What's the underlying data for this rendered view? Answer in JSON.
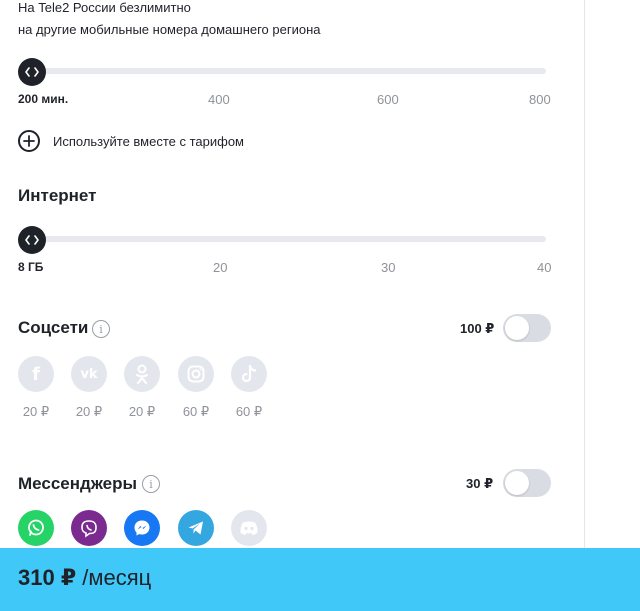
{
  "calls": {
    "line1": "На Tele2 России безлимитно",
    "line2": "на другие мобильные номера домашнего региона",
    "ticks": [
      "200 мин.",
      "400",
      "600",
      "800"
    ],
    "add_option_label": "Используйте вместе с тарифом"
  },
  "internet": {
    "title": "Интернет",
    "ticks": [
      "8 ГБ",
      "20",
      "30",
      "40"
    ]
  },
  "social": {
    "title": "Соцсети",
    "price": "100 ₽",
    "enabled": false,
    "apps": [
      {
        "icon": "facebook-icon",
        "price": "20 ₽"
      },
      {
        "icon": "vk-icon",
        "price": "20 ₽"
      },
      {
        "icon": "odnoklassniki-icon",
        "price": "20 ₽"
      },
      {
        "icon": "instagram-icon",
        "price": "60 ₽"
      },
      {
        "icon": "tiktok-icon",
        "price": "60 ₽"
      }
    ]
  },
  "messengers": {
    "title": "Мессенджеры",
    "price": "30 ₽",
    "enabled": false,
    "apps": [
      {
        "icon": "whatsapp-icon",
        "color": "#25d366"
      },
      {
        "icon": "viber-icon",
        "color": "#7b2a8f"
      },
      {
        "icon": "messenger-icon",
        "color": "#1877f2"
      },
      {
        "icon": "telegram-icon",
        "color": "#34a7e0"
      },
      {
        "icon": "discord-icon",
        "color": "#e3e6ec"
      }
    ]
  },
  "footer": {
    "amount": "310 ₽",
    "period": "/месяц",
    "background": "#3fc8f8"
  }
}
